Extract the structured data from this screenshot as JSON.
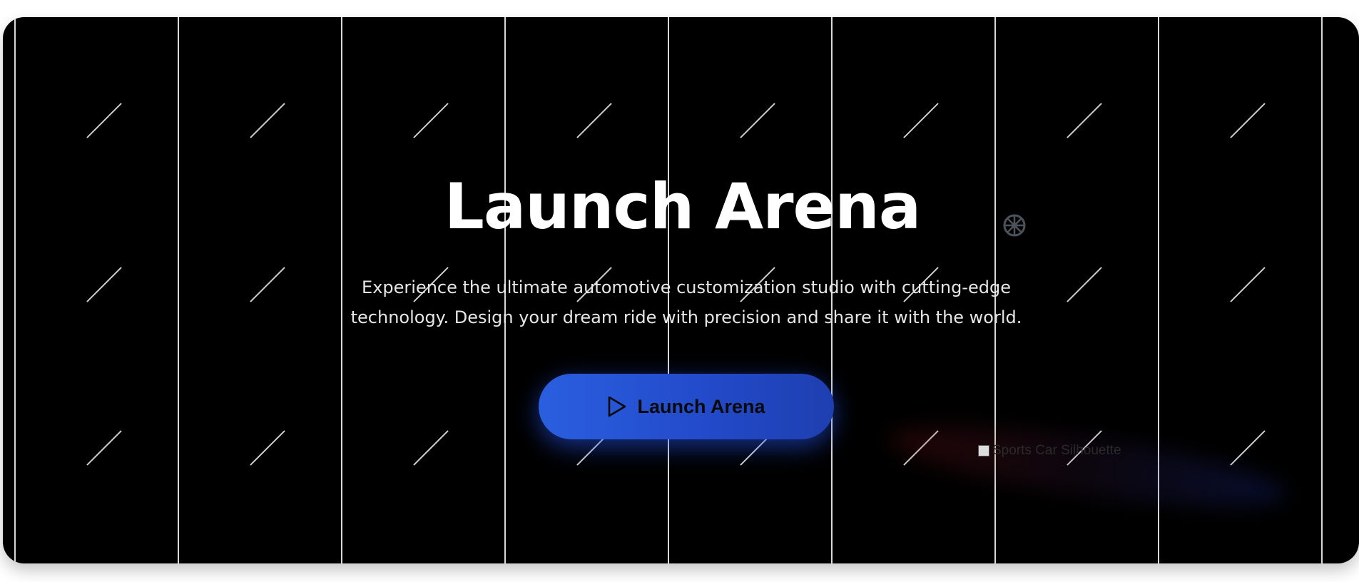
{
  "hero": {
    "title": "Launch Arena",
    "subtitle": "Experience the ultimate automotive customization studio with cutting-edge technology. Design your dream ride with precision and share it with the world.",
    "cta_label": "Launch Arena",
    "cta_icon": "play-icon",
    "decor_icon": "steering-wheel-icon",
    "image_alt": "Sports Car Silhouette"
  },
  "colors": {
    "background": "#000000",
    "cta_start": "#2a5fe0",
    "cta_end": "#1e3fb0",
    "text": "#ffffff",
    "lines": "#d8d8d8"
  }
}
